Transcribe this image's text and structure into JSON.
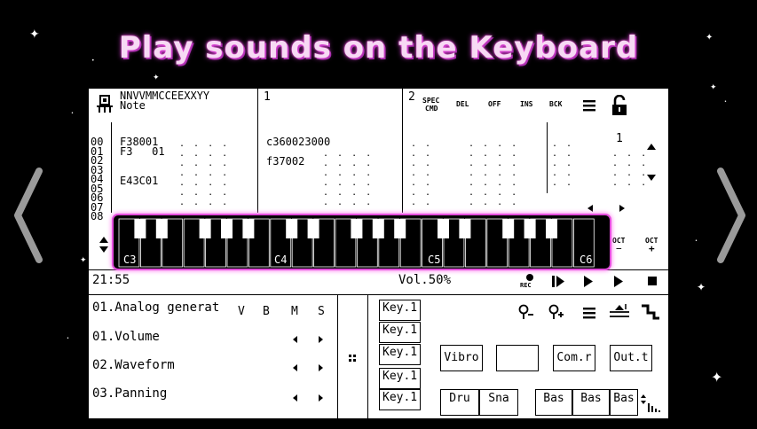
{
  "headline": "Play sounds on the Keyboard",
  "header": {
    "pattern_chars": "NNVVMMCCEEXXYY",
    "note_label": "Note",
    "track1_num": "1",
    "track2_num": "2",
    "spec_cmd": [
      "SPEC",
      "CMD"
    ],
    "del": "DEL",
    "off": "OFF",
    "ins": "INS",
    "bck": "BCK",
    "right_num": "1"
  },
  "rows": [
    "00",
    "01",
    "02",
    "03",
    "04",
    "05",
    "06",
    "07",
    "08"
  ],
  "track0": {
    "r0": "F38001",
    "r1": "F3   01",
    "r4": "E43C01"
  },
  "track1": {
    "r0": "c360023000",
    "r2": "f37002"
  },
  "piano": {
    "octaves": [
      "C3",
      "C4",
      "C5",
      "C6"
    ],
    "oct_minus": "OCT",
    "oct_minus_sign": "−",
    "oct_plus": "OCT",
    "oct_plus_sign": "+"
  },
  "transport": {
    "time": "21:55",
    "volume": "Vol.50%",
    "rec": "REC"
  },
  "instrument": {
    "name": "01.Analog generat",
    "cols": [
      "V",
      "B",
      "M",
      "S"
    ],
    "params": [
      "01.Volume",
      "02.Waveform",
      "03.Panning"
    ]
  },
  "key_slots": [
    "Key.1",
    "Key.1",
    "Key.1",
    "Key.1",
    "Key.1"
  ],
  "effects": {
    "vibro": "Vibro",
    "blank": "",
    "comr": "Com.r",
    "outt": "Out.t"
  },
  "drums": [
    "Dru",
    "Sna",
    "Bas",
    "Bas",
    "Bas"
  ],
  "icons": {
    "lock": "lock-open-icon",
    "zoom_out": "zoom-out-icon",
    "zoom_in": "zoom-in-icon"
  },
  "colors": {
    "accent": "#e34ddc",
    "headline": "#f7d9f4",
    "background": "#000000",
    "screen": "#ffffff"
  }
}
